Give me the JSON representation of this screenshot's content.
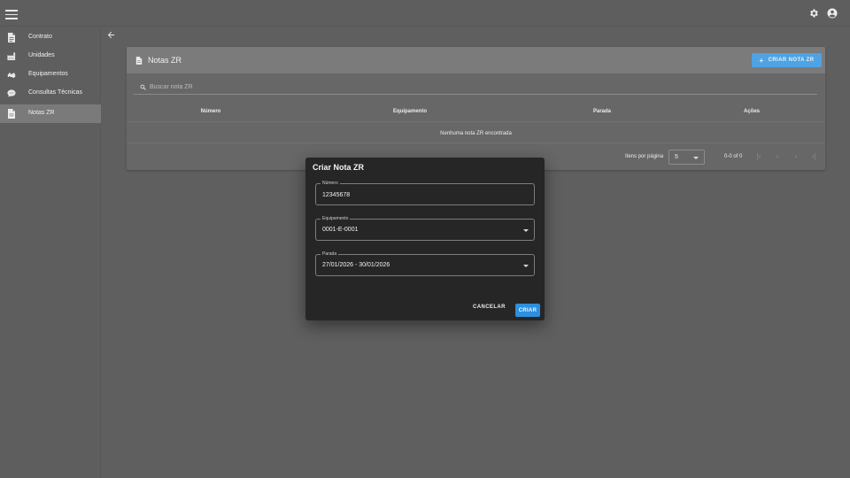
{
  "topbar": {
    "menu_icon": "hamburger-menu-icon",
    "settings_icon": "gear-icon",
    "account_icon": "account-circle-icon"
  },
  "sidebar": {
    "items": [
      {
        "label": "Contrato",
        "icon": "document-icon",
        "active": false
      },
      {
        "label": "Unidades",
        "icon": "factory-icon",
        "active": false
      },
      {
        "label": "Equipamentos",
        "icon": "equipment-icon",
        "active": false
      },
      {
        "label": "Consultas Técnicas",
        "icon": "chat-icon",
        "active": false
      },
      {
        "label": "Notas ZR",
        "icon": "notes-icon",
        "active": true
      }
    ]
  },
  "main": {
    "back_icon": "arrow-back-icon",
    "card": {
      "title": "Notas ZR",
      "create_label": "CRIAR NOTA ZR",
      "search_placeholder": "Buscar nota ZR",
      "columns": [
        "Número",
        "Equipamento",
        "Parada",
        "Ações"
      ],
      "empty_message": "Nenhuma nota ZR encontrada",
      "pagination": {
        "items_per_page_label": "Itens por página",
        "page_size": "5",
        "range": "0-0 of 0"
      }
    }
  },
  "dialog": {
    "title": "Criar Nota ZR",
    "numero_label": "Número",
    "numero_value": "12345678",
    "equipamento_label": "Equipamento",
    "equipamento_value": "0001-E-0001",
    "parada_label": "Parada",
    "parada_value": "27/01/2026 - 30/01/2026",
    "cancel_label": "CANCELAR",
    "create_label": "CRIAR"
  },
  "colors": {
    "accent": "#2d8fdd",
    "accent_light": "#4fa3e3",
    "dialog_bg": "#262626",
    "page_bg": "#5f5f5f"
  }
}
